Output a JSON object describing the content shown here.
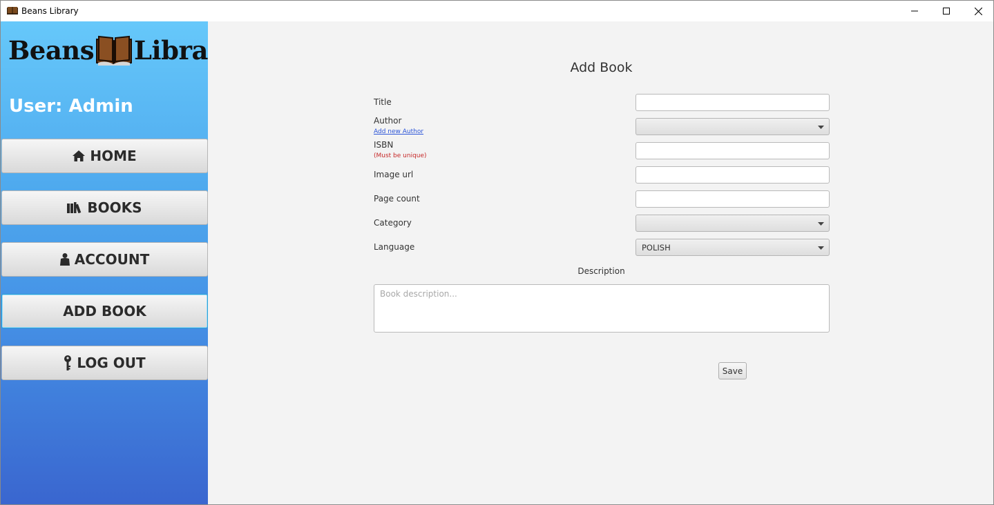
{
  "window": {
    "title": "Beans Library",
    "app_icon": "book-icon",
    "controls": [
      "minimize-icon",
      "maximize-icon",
      "close-icon"
    ]
  },
  "sidebar": {
    "logo": {
      "left": "Beans",
      "right": "Library",
      "icon": "open-book-icon"
    },
    "user_label": "User: Admin",
    "items": [
      {
        "label": "HOME",
        "icon": "home-icon"
      },
      {
        "label": "BOOKS",
        "icon": "books-icon"
      },
      {
        "label": "ACCOUNT",
        "icon": "person-icon"
      },
      {
        "label": "ADD BOOK",
        "icon": "",
        "active": true
      },
      {
        "label": "LOG OUT",
        "icon": "key-icon"
      }
    ],
    "colors": {
      "gradient_top": "#66c8fa",
      "gradient_bottom": "#3a66cf"
    }
  },
  "main": {
    "title": "Add Book",
    "fields": {
      "title": {
        "label": "Title",
        "value": ""
      },
      "author": {
        "label": "Author",
        "link": "Add new Author",
        "value": ""
      },
      "isbn": {
        "label": "ISBN",
        "note": "(Must be unique)",
        "value": ""
      },
      "image_url": {
        "label": "Image url",
        "value": ""
      },
      "page_count": {
        "label": "Page count",
        "value": ""
      },
      "category": {
        "label": "Category",
        "value": ""
      },
      "language": {
        "label": "Language",
        "value": "POLISH"
      }
    },
    "description": {
      "label": "Description",
      "placeholder": "Book description..."
    },
    "save_label": "Save"
  }
}
